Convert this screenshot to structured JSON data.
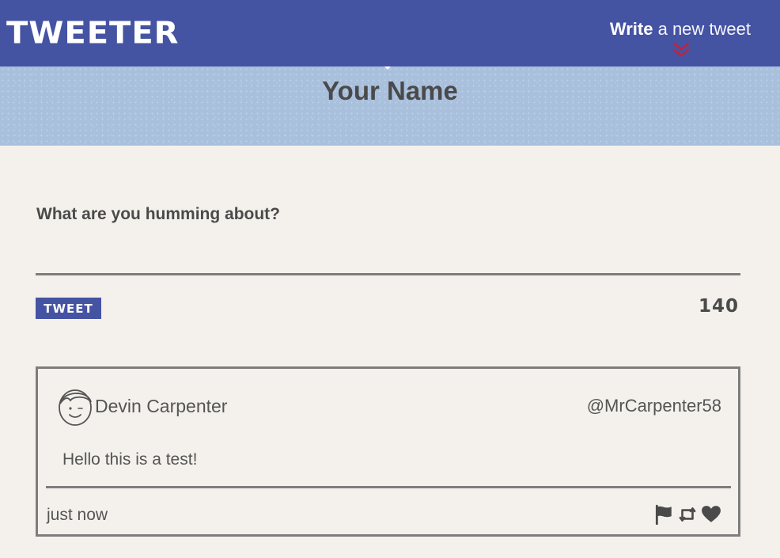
{
  "nav": {
    "brand": "TWEETER",
    "compose_strong": "Write",
    "compose_rest": " a new tweet",
    "compose_icon": "double-chevron-down-icon",
    "chevron_color": "#c0243b"
  },
  "header": {
    "name": "Your Name"
  },
  "composer": {
    "label": "What are you humming about?",
    "placeholder": "",
    "value": "",
    "button_label": "TWEET",
    "counter": "140"
  },
  "tweets": [
    {
      "name": "Devin Carpenter",
      "handle": "@MrCarpenter58",
      "text": "Hello this is a test!",
      "time": "just now",
      "actions": [
        "flag-icon",
        "retweet-icon",
        "heart-icon"
      ]
    }
  ],
  "colors": {
    "nav": "#4553a3",
    "header": "#a9c0dd",
    "page": "#f4f1ec",
    "text": "#4a4a4a"
  }
}
